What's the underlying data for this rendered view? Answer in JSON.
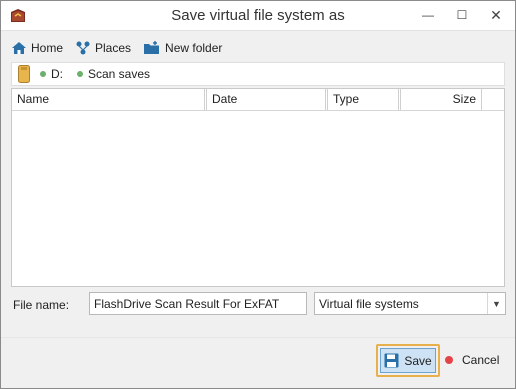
{
  "window": {
    "title": "Save virtual file system as",
    "minimize_symbol": "—",
    "maximize_symbol": "☐",
    "close_symbol": "✕"
  },
  "toolbar": {
    "home_label": "Home",
    "places_label": "Places",
    "new_folder_label": "New folder"
  },
  "path": {
    "segments": [
      "D:",
      "Scan saves"
    ]
  },
  "list": {
    "columns": [
      "Name",
      "Date",
      "Type",
      "Size"
    ],
    "rows": []
  },
  "form": {
    "file_name_label": "File name:",
    "file_name_value": "FlashDrive Scan Result For ExFAT",
    "file_type_value": "Virtual file systems",
    "dropdown_arrow": "▼"
  },
  "buttons": {
    "save_label": "Save",
    "cancel_label": "Cancel"
  },
  "colors": {
    "accent_blue": "#2a6fa8",
    "save_focus_outline": "#e8b04c",
    "cancel_dot": "#e5434a",
    "path_dot": "#6bb16b"
  }
}
